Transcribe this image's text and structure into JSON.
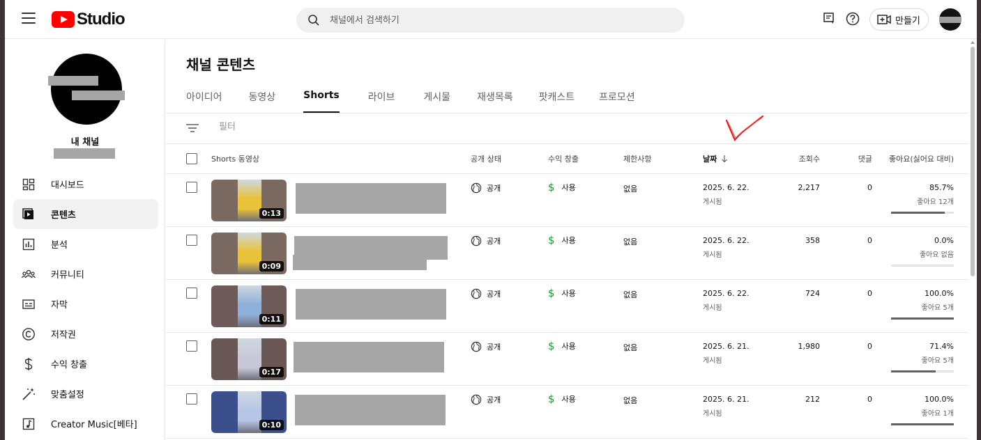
{
  "header": {
    "logo_text": "Studio",
    "search_placeholder": "채널에서 검색하기",
    "create_label": "만들기"
  },
  "sidebar": {
    "channel_label": "내 채널",
    "items": [
      {
        "label": "대시보드",
        "icon": "dashboard-icon"
      },
      {
        "label": "콘텐츠",
        "icon": "content-icon",
        "active": true
      },
      {
        "label": "분석",
        "icon": "analytics-icon"
      },
      {
        "label": "커뮤니티",
        "icon": "community-icon"
      },
      {
        "label": "자막",
        "icon": "subtitles-icon"
      },
      {
        "label": "저작권",
        "icon": "copyright-icon"
      },
      {
        "label": "수익 창출",
        "icon": "monetization-icon"
      },
      {
        "label": "맞춤설정",
        "icon": "customization-icon"
      },
      {
        "label": "Creator Music[베타]",
        "icon": "music-icon"
      }
    ]
  },
  "main": {
    "title": "채널 콘텐츠",
    "tabs": [
      "아이디어",
      "동영상",
      "Shorts",
      "라이브",
      "게시물",
      "재생목록",
      "팟캐스트",
      "프로모션"
    ],
    "active_tab": "Shorts",
    "filter_placeholder": "필터"
  },
  "table": {
    "headers": {
      "video": "Shorts 동영상",
      "visibility": "공개 상태",
      "monetization": "수익 창출",
      "restrictions": "제한사항",
      "date": "날짜",
      "views": "조회수",
      "comments": "댓글",
      "likes": "좋아요(싫어요 대비)"
    },
    "rows": [
      {
        "duration": "0:13",
        "visibility": "공개",
        "monetization": "사용",
        "restrictions": "없음",
        "date": "2025. 6. 22.",
        "date_status": "게시됨",
        "views": "2,217",
        "comments": "0",
        "like_pct": "85.7%",
        "like_sub": "좋아요 12개",
        "like_ratio": 0.857,
        "thumb_bg": "#7a6a62",
        "fig_color": "#e9c23a"
      },
      {
        "duration": "0:09",
        "visibility": "공개",
        "monetization": "사용",
        "restrictions": "없음",
        "date": "2025. 6. 22.",
        "date_status": "게시됨",
        "views": "358",
        "comments": "0",
        "like_pct": "0.0%",
        "like_sub": "좋아요 없음",
        "like_ratio": 0.0,
        "thumb_bg": "#7a6a62",
        "fig_color": "#e9c23a"
      },
      {
        "duration": "0:11",
        "visibility": "공개",
        "monetization": "사용",
        "restrictions": "없음",
        "date": "2025. 6. 22.",
        "date_status": "게시됨",
        "views": "724",
        "comments": "0",
        "like_pct": "100.0%",
        "like_sub": "좋아요 5개",
        "like_ratio": 1.0,
        "thumb_bg": "#6e5a58",
        "fig_color": "#8fb0d8"
      },
      {
        "duration": "0:17",
        "visibility": "공개",
        "monetization": "사용",
        "restrictions": "없음",
        "date": "2025. 6. 21.",
        "date_status": "게시됨",
        "views": "1,980",
        "comments": "0",
        "like_pct": "71.4%",
        "like_sub": "좋아요 5개",
        "like_ratio": 0.714,
        "thumb_bg": "#6a5856",
        "fig_color": "#c8c8d8"
      },
      {
        "duration": "0:10",
        "visibility": "공개",
        "monetization": "사용",
        "restrictions": "없음",
        "date": "2025. 6. 21.",
        "date_status": "게시됨",
        "views": "212",
        "comments": "0",
        "like_pct": "100.0%",
        "like_sub": "좋아요 1개",
        "like_ratio": 1.0,
        "thumb_bg": "#3a4f8c",
        "fig_color": "#b7c6e6"
      }
    ]
  },
  "colors": {
    "brand": "#ff0000",
    "monetization": "#1a9b2c",
    "annotation": "#e02020"
  }
}
